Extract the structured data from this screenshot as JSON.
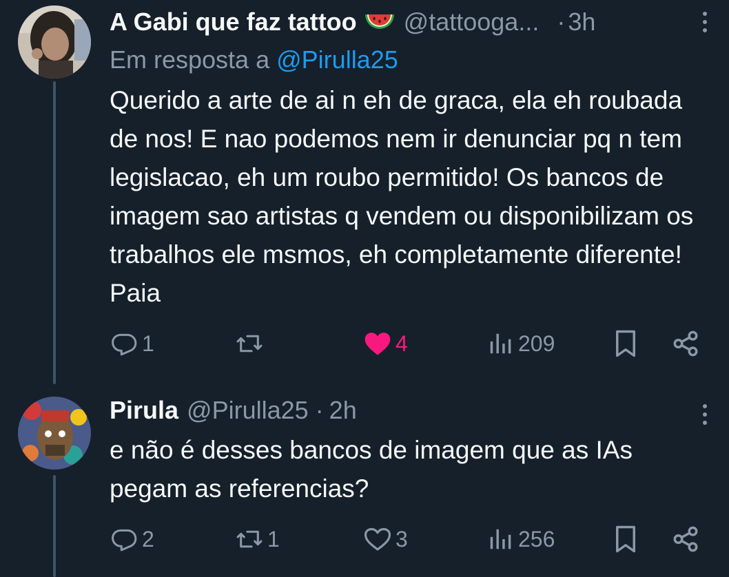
{
  "tweets": [
    {
      "name": "A Gabi que faz tattoo",
      "emoji": "watermelon-emoji",
      "handle": "@tattooga...",
      "separator": "·",
      "time": "3h",
      "reply_prefix": "Em resposta a",
      "reply_mention": "@Pirulla25",
      "text": "Querido a arte de ai n eh de graca, ela eh roubada de nos! E nao podemos nem ir denunciar pq n tem legislacao, eh um roubo permitido! Os bancos de imagem sao artistas q vendem ou disponibilizam os trabalhos ele msmos, eh completamente diferente! Paia",
      "actions": {
        "replies": "1",
        "retweets": "",
        "likes": "4",
        "liked": true,
        "views": "209"
      }
    },
    {
      "name": "Pirula",
      "handle": "@Pirulla25",
      "separator": "·",
      "time": "2h",
      "text": "e não é desses bancos de imagem que as IAs pegam as referencias?",
      "actions": {
        "replies": "2",
        "retweets": "1",
        "likes": "3",
        "liked": false,
        "views": "256"
      }
    }
  ],
  "colors": {
    "background": "#15202b",
    "text": "#f7f9f9",
    "secondary": "#8b98a5",
    "link": "#1d9bf0",
    "like": "#f91880",
    "thread_line": "#3d5466"
  },
  "icons": [
    "reply-icon",
    "retweet-icon",
    "heart-icon",
    "views-icon",
    "bookmark-icon",
    "share-icon",
    "more-icon"
  ]
}
